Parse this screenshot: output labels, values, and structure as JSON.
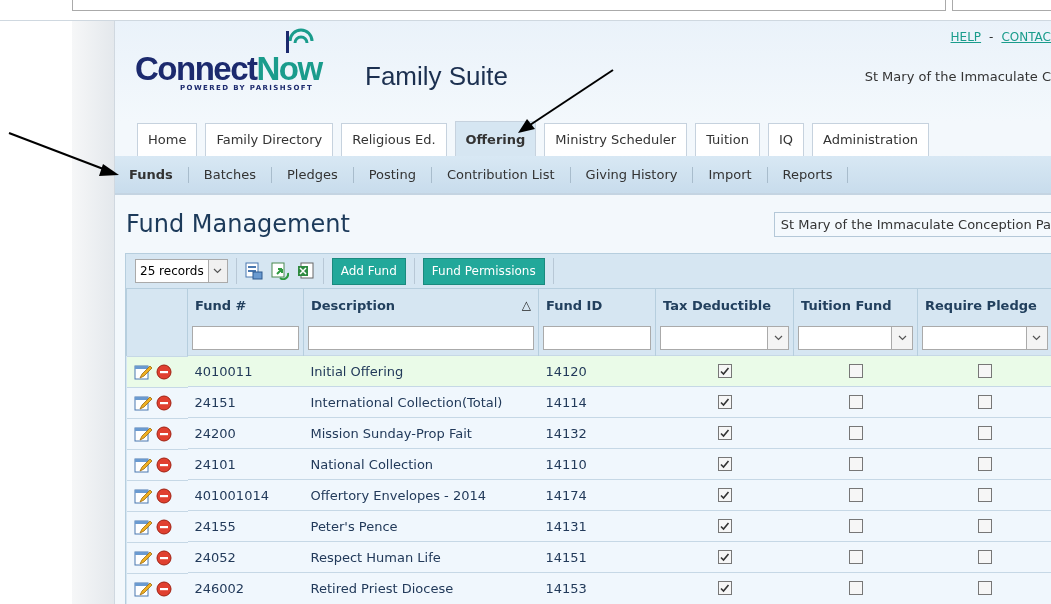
{
  "header": {
    "logo": {
      "word_1": "Connect",
      "word_2": "Now",
      "tagline": "POWERED BY PARISHSOFT"
    },
    "suite_title": "Family Suite",
    "links": [
      "HELP",
      "CONTAC"
    ],
    "link_separator": "-",
    "parish": "St Mary of the Immaculate C"
  },
  "tabs": [
    {
      "label": "Home",
      "selected": false
    },
    {
      "label": "Family Directory",
      "selected": false
    },
    {
      "label": "Religious Ed.",
      "selected": false
    },
    {
      "label": "Offering",
      "selected": true
    },
    {
      "label": "Ministry Scheduler",
      "selected": false
    },
    {
      "label": "Tuition",
      "selected": false
    },
    {
      "label": "IQ",
      "selected": false
    },
    {
      "label": "Administration",
      "selected": false
    }
  ],
  "subnav": [
    {
      "label": "Funds",
      "selected": true
    },
    {
      "label": "Batches",
      "selected": false
    },
    {
      "label": "Pledges",
      "selected": false
    },
    {
      "label": "Posting",
      "selected": false
    },
    {
      "label": "Contribution List",
      "selected": false
    },
    {
      "label": "Giving History",
      "selected": false
    },
    {
      "label": "Import",
      "selected": false
    },
    {
      "label": "Reports",
      "selected": false
    }
  ],
  "page_title": "Fund Management",
  "parish_select": "St Mary of the Immaculate Conception Pa",
  "toolbar": {
    "records": "25 records",
    "buttons": [
      "Add Fund",
      "Fund Permissions"
    ]
  },
  "table": {
    "columns": [
      {
        "label": "Fund #",
        "kind": "text"
      },
      {
        "label": "Description",
        "kind": "text",
        "sorted": true,
        "sort_mark": "△"
      },
      {
        "label": "Fund ID",
        "kind": "text"
      },
      {
        "label": "Tax Deductible",
        "kind": "select"
      },
      {
        "label": "Tuition Fund",
        "kind": "select"
      },
      {
        "label": "Require Pledge",
        "kind": "select"
      }
    ],
    "rows": [
      {
        "fund_no": "4010011",
        "description": "Initial Offering",
        "fund_id": "14120",
        "tax_deductible": true,
        "tuition_fund": false,
        "require_pledge": false,
        "selected": true
      },
      {
        "fund_no": "24151",
        "description": "International Collection(Total)",
        "fund_id": "14114",
        "tax_deductible": true,
        "tuition_fund": false,
        "require_pledge": false,
        "selected": false
      },
      {
        "fund_no": "24200",
        "description": "Mission Sunday-Prop Fait",
        "fund_id": "14132",
        "tax_deductible": true,
        "tuition_fund": false,
        "require_pledge": false,
        "selected": false
      },
      {
        "fund_no": "24101",
        "description": "National Collection",
        "fund_id": "14110",
        "tax_deductible": true,
        "tuition_fund": false,
        "require_pledge": false,
        "selected": false
      },
      {
        "fund_no": "401001014",
        "description": "Offertory Envelopes - 2014",
        "fund_id": "14174",
        "tax_deductible": true,
        "tuition_fund": false,
        "require_pledge": false,
        "selected": false
      },
      {
        "fund_no": "24155",
        "description": "Peter's Pence",
        "fund_id": "14131",
        "tax_deductible": true,
        "tuition_fund": false,
        "require_pledge": false,
        "selected": false
      },
      {
        "fund_no": "24052",
        "description": "Respect Human Life",
        "fund_id": "14151",
        "tax_deductible": true,
        "tuition_fund": false,
        "require_pledge": false,
        "selected": false
      },
      {
        "fund_no": "246002",
        "description": "Retired Priest Diocese",
        "fund_id": "14153",
        "tax_deductible": true,
        "tuition_fund": false,
        "require_pledge": false,
        "selected": false
      }
    ]
  }
}
